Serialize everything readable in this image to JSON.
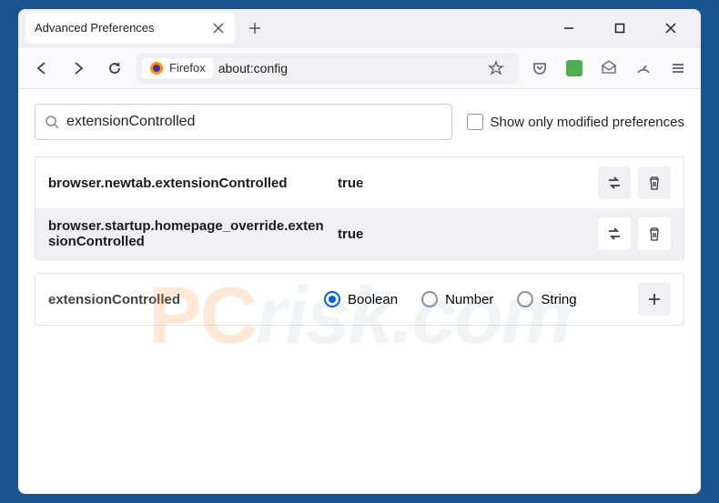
{
  "window": {
    "tab_title": "Advanced Preferences"
  },
  "urlbar": {
    "identity": "Firefox",
    "url": "about:config"
  },
  "search": {
    "value": "extensionControlled",
    "show_only_label": "Show only modified preferences"
  },
  "prefs": [
    {
      "name": "browser.newtab.extensionControlled",
      "value": "true"
    },
    {
      "name": "browser.startup.homepage_override.extensionControlled",
      "value": "true"
    }
  ],
  "new_pref": {
    "name": "extensionControlled",
    "types": {
      "boolean": "Boolean",
      "number": "Number",
      "string": "String"
    },
    "selected": "boolean"
  },
  "watermark": {
    "p": "P",
    "c": "C",
    "rest": "risk.com"
  }
}
